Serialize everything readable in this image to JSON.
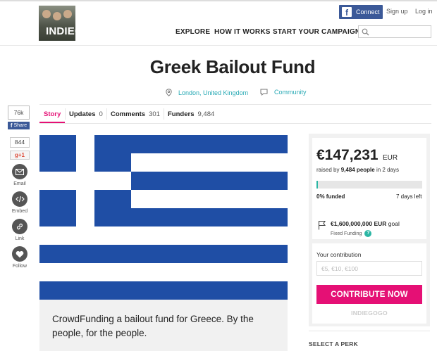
{
  "header": {
    "logo_text": "INDIEGOGO",
    "connect_label": "Connect",
    "signup_label": "Sign up",
    "login_label": "Log in",
    "nav": [
      "EXPLORE",
      "HOW IT WORKS",
      "START YOUR CAMPAIGN"
    ],
    "search_placeholder": ""
  },
  "campaign": {
    "title": "Greek Bailout Fund",
    "location": "London, United Kingdom",
    "category": "Community",
    "tabs": [
      {
        "label": "Story",
        "count": ""
      },
      {
        "label": "Updates",
        "count": "0"
      },
      {
        "label": "Comments",
        "count": "301"
      },
      {
        "label": "Funders",
        "count": "9,484"
      }
    ],
    "description": "CrowdFunding a bailout fund for Greece. By the people, for the people."
  },
  "share": {
    "fb_count": "76k",
    "fb_share_label": "Share",
    "gplus_count": "844",
    "gplus_label": "g+1",
    "actions": [
      "Email",
      "Embed",
      "Link",
      "Follow"
    ]
  },
  "funding": {
    "amount": "€147,231",
    "currency": "EUR",
    "raised_prefix": "raised by ",
    "people": "9,484 people",
    "raised_suffix": " in 2 days",
    "funded_pct": "0% funded",
    "progress_fraction": 0.009,
    "days_left": "7 days left",
    "goal_amount": "€1,600,000,000 EUR",
    "goal_suffix": " goal",
    "fixed_label": "Fixed Funding",
    "contribution_label": "Your contribution",
    "contribution_placeholder": "€5, €10, €100",
    "contribute_button": "CONTRIBUTE NOW",
    "footer_logo": "INDIEGOGO",
    "perk_heading": "SELECT A PERK"
  },
  "colors": {
    "accent": "#e51075",
    "teal": "#2bb6a4",
    "facebook": "#3b5998",
    "flag_blue": "#1f4ea5"
  }
}
